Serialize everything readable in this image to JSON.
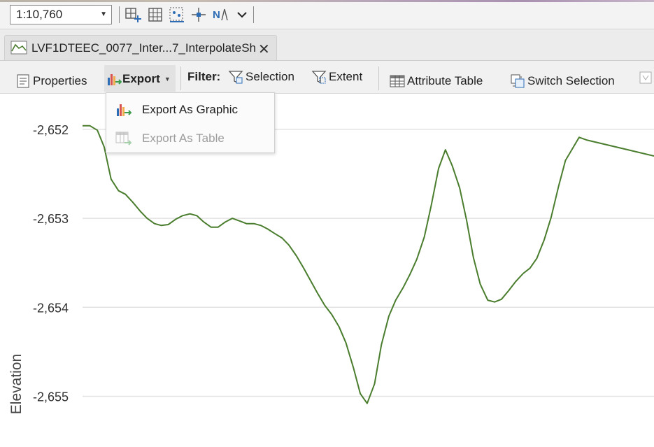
{
  "scale": {
    "value": "1:10,760"
  },
  "mini_toolbar": {
    "icons": [
      "add-grid-icon",
      "table-grid-icon",
      "select-points-icon",
      "move-crosshair-icon",
      "north-arrow-icon",
      "overflow-chevron-icon"
    ]
  },
  "tab": {
    "title": "LVF1DTEEC_0077_Inter...7_InterpolateSh"
  },
  "toolbar": {
    "properties": "Properties",
    "export": "Export",
    "filter_label": "Filter:",
    "selection": "Selection",
    "extent": "Extent",
    "attribute_table": "Attribute Table",
    "switch_selection": "Switch Selection"
  },
  "export_menu": {
    "items": [
      {
        "label": "Export As Graphic",
        "enabled": true
      },
      {
        "label": "Export As Table",
        "enabled": false
      }
    ]
  },
  "colors": {
    "line": "#4a7d2d",
    "grid": "#e3e3e3",
    "toolbar_bg": "#f1f1f1"
  },
  "chart_data": {
    "type": "line",
    "xlabel": "",
    "ylabel": "Elevation",
    "y_ticks": [
      "-2,652",
      "-2,653",
      "-2,654",
      "-2,655"
    ],
    "y_tick_values": [
      -2652,
      -2653,
      -2654,
      -2655
    ],
    "ylim": [
      -2655.57,
      -2651.6
    ],
    "xlim": [
      0,
      100
    ],
    "grid": true,
    "legend": "none",
    "series": [
      {
        "values": [
          [
            0,
            -2651.96
          ],
          [
            1.3,
            -2651.96
          ],
          [
            2.6,
            -2652.01
          ],
          [
            3.8,
            -2652.2
          ],
          [
            5.0,
            -2652.56
          ],
          [
            6.3,
            -2652.69
          ],
          [
            7.5,
            -2652.73
          ],
          [
            8.8,
            -2652.82
          ],
          [
            10.1,
            -2652.92
          ],
          [
            11.3,
            -2653.0
          ],
          [
            12.6,
            -2653.06
          ],
          [
            13.8,
            -2653.08
          ],
          [
            15.0,
            -2653.07
          ],
          [
            16.3,
            -2653.01
          ],
          [
            17.5,
            -2652.97
          ],
          [
            18.8,
            -2652.95
          ],
          [
            20.0,
            -2652.97
          ],
          [
            21.2,
            -2653.04
          ],
          [
            22.5,
            -2653.1
          ],
          [
            23.7,
            -2653.1
          ],
          [
            25.0,
            -2653.04
          ],
          [
            26.2,
            -2653.0
          ],
          [
            27.5,
            -2653.03
          ],
          [
            28.7,
            -2653.06
          ],
          [
            30.0,
            -2653.06
          ],
          [
            31.2,
            -2653.08
          ],
          [
            32.4,
            -2653.12
          ],
          [
            33.6,
            -2653.17
          ],
          [
            34.9,
            -2653.22
          ],
          [
            36.1,
            -2653.3
          ],
          [
            37.4,
            -2653.42
          ],
          [
            38.6,
            -2653.55
          ],
          [
            39.9,
            -2653.7
          ],
          [
            41.1,
            -2653.84
          ],
          [
            42.4,
            -2653.98
          ],
          [
            43.6,
            -2654.08
          ],
          [
            44.9,
            -2654.22
          ],
          [
            46.1,
            -2654.4
          ],
          [
            47.4,
            -2654.68
          ],
          [
            48.6,
            -2654.97
          ],
          [
            49.8,
            -2655.08
          ],
          [
            51.1,
            -2654.86
          ],
          [
            52.3,
            -2654.42
          ],
          [
            53.6,
            -2654.1
          ],
          [
            54.8,
            -2653.92
          ],
          [
            56.1,
            -2653.78
          ],
          [
            57.3,
            -2653.63
          ],
          [
            58.5,
            -2653.46
          ],
          [
            59.8,
            -2653.21
          ],
          [
            61.0,
            -2652.86
          ],
          [
            62.3,
            -2652.44
          ],
          [
            63.5,
            -2652.23
          ],
          [
            64.7,
            -2652.41
          ],
          [
            66.0,
            -2652.66
          ],
          [
            67.2,
            -2653.02
          ],
          [
            68.4,
            -2653.44
          ],
          [
            69.6,
            -2653.74
          ],
          [
            70.9,
            -2653.92
          ],
          [
            72.1,
            -2653.94
          ],
          [
            73.3,
            -2653.91
          ],
          [
            74.6,
            -2653.81
          ],
          [
            75.8,
            -2653.71
          ],
          [
            77.1,
            -2653.62
          ],
          [
            78.3,
            -2653.56
          ],
          [
            79.5,
            -2653.45
          ],
          [
            80.8,
            -2653.24
          ],
          [
            82.0,
            -2652.99
          ],
          [
            83.3,
            -2652.64
          ],
          [
            84.5,
            -2652.35
          ],
          [
            85.7,
            -2652.22
          ],
          [
            86.9,
            -2652.09
          ],
          [
            88.2,
            -2652.12
          ],
          [
            100,
            -2652.3
          ]
        ]
      }
    ]
  }
}
